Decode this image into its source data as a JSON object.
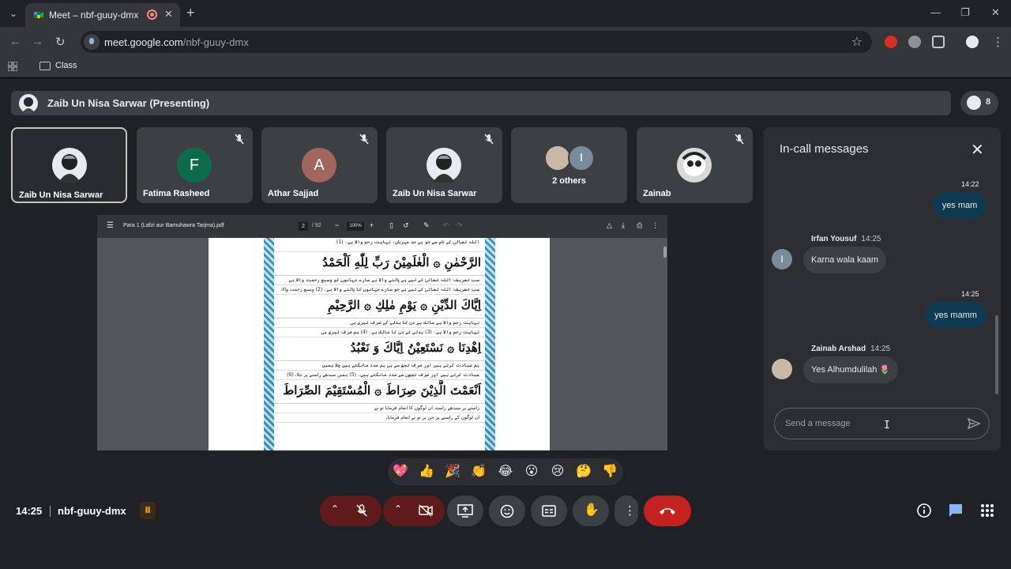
{
  "browser": {
    "tab_title": "Meet – nbf-guuy-dmx",
    "url_host": "meet.google.com",
    "url_path": "/nbf-guuy-dmx",
    "bookmark_folder": "Class"
  },
  "meet": {
    "presenter_label": "Zaib Un Nisa Sarwar (Presenting)",
    "participant_count": "8",
    "tiles": [
      {
        "name": "Zaib Un Nisa Sarwar",
        "initial": "",
        "color": "#e8eaed",
        "muted": false,
        "active": true
      },
      {
        "name": "Fatima Rasheed",
        "initial": "F",
        "color": "#0b6b4a",
        "muted": true,
        "active": false
      },
      {
        "name": "Athar Sajjad",
        "initial": "A",
        "color": "#a1665e",
        "muted": true,
        "active": false
      },
      {
        "name": "Zaib Un Nisa Sarwar",
        "initial": "",
        "color": "#e8eaed",
        "muted": true,
        "active": false
      },
      {
        "name": "2 others",
        "initial": "I",
        "color": "#7a8c99",
        "muted": false,
        "active": false
      },
      {
        "name": "Zainab",
        "initial": "",
        "color": "#d9d9d9",
        "muted": true,
        "active": false
      }
    ]
  },
  "pdf": {
    "file_name": "Para 1 (Lafzi aur Bamuhawra Tarjma).pdf",
    "page": "2",
    "page_total": "/ 92",
    "zoom": "100%",
    "arabic_lines": [
      "الرَّحْمٰنِ ۞ الْعٰلَمِيْنَ رَبِّ لِلّٰهِ اَلْحَمْدُ",
      "اِيَّاكَ الدِّيْنِ ۞ يَوْمِ مٰلِكِ ۞ الرَّحِيْمِ",
      "اِهْدِنَا ۞ نَسْتَعِيْنُ اِيَّاكَ وَ نَعْبُدُ",
      "اَنْعَمْتَ الَّذِيْنَ صِرَاطَ ۞ الْمُسْتَقِيْمَ الصِّرَاطَ"
    ],
    "urdu_lines": [
      "اللہ تعالیٰ کے نام سے جو بے حد مہربان، نہایت رحم والا ہے۔ (1)",
      "سب تعریف اللہ تعالیٰ کے لیے ہے پالنے والا ہے سارے جہانوں کو وسیع رحمت والا ہے",
      "سب تعریف اللہ تعالیٰ کے لیے ہے جو سارے جہانوں کا پالنے والا ہے۔ (2) وسیع رحمت والا،",
      "نہایت رحم والا ہے مالک ہے دن کا بدلے کے صرف تیری ہی",
      "نہایت رحم والا ہے۔ (3) بدلے کے دن کا مالک ہے۔ (4) ہم صرف تیری ہی",
      "ہم عبادت کرتے ہیں اور صرف تجھ سے ہی ہم مدد مانگتے ہیں چلا ہمیں",
      "عبادت کرتے ہیں اور صرف تجھی سے مدد مانگتے ہیں۔ (5) ہمیں سیدھے راستے پر چلا، (6)",
      "راستے پر سیدھے راستہ ان لوگوں کا انعام فرمایا تو نے",
      "ان لوگوں کے راستے پر جن پر تو نے انعام فرمایا،"
    ]
  },
  "reactions": [
    "💖",
    "👍",
    "🎉",
    "👏",
    "😂",
    "😮",
    "😢",
    "🤔",
    "👎"
  ],
  "chat": {
    "title": "In-call messages",
    "messages": [
      {
        "type": "out",
        "time": "14:22",
        "text": "yes mam"
      },
      {
        "type": "in",
        "sender": "Irfan Yousuf",
        "time": "14:25",
        "text": "Karna wala kaam",
        "initial": "I",
        "color": "#7a8c99"
      },
      {
        "type": "out",
        "time": "14:25",
        "text": "yes mamm"
      },
      {
        "type": "in",
        "sender": "Zainab Arshad",
        "time": "14:25",
        "text": "Yes Alhumdulilah 🌷",
        "initial": "",
        "color": "#c9b8a6"
      }
    ],
    "input_placeholder": "Send a message"
  },
  "bottom": {
    "clock": "14:25",
    "meeting_code": "nbf-guuy-dmx"
  },
  "colors": {
    "meet_bg": "#202124",
    "end_call": "#c5221f",
    "muted_control": "#5f1b1b",
    "outgoing_bubble": "#0f3a52",
    "accent_blue": "#8ab4f8"
  }
}
